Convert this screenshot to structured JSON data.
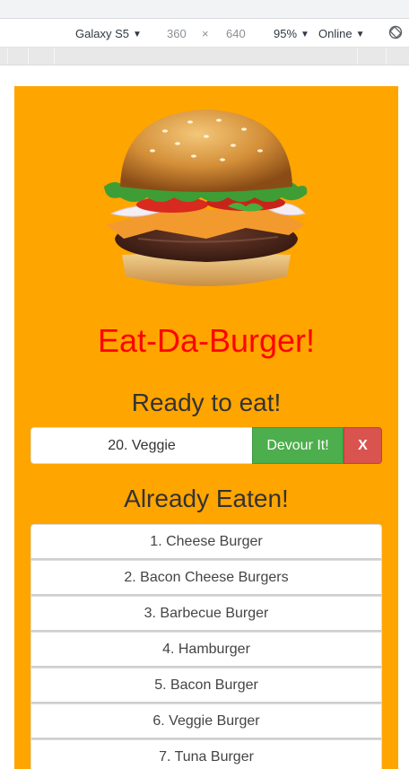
{
  "devtools": {
    "device": "Galaxy S5",
    "width": "360",
    "times": "×",
    "height": "640",
    "zoom": "95%",
    "network": "Online"
  },
  "page": {
    "title": "Eat-Da-Burger!",
    "ready_heading": "Ready to eat!",
    "eaten_heading": "Already Eaten!",
    "ready_burger": "20. Veggie",
    "devour_label": "Devour It!",
    "delete_label": "X",
    "eaten_burgers": [
      "1. Cheese Burger",
      "2. Bacon Cheese Burgers",
      "3. Barbecue Burger",
      "4. Hamburger",
      "5. Bacon Burger",
      "6. Veggie Burger",
      "7. Tuna Burger"
    ]
  },
  "colors": {
    "page_background": "#ffa500",
    "title_color": "#ff0000",
    "devour_button": "#4cae4c",
    "delete_button": "#d9534f"
  }
}
